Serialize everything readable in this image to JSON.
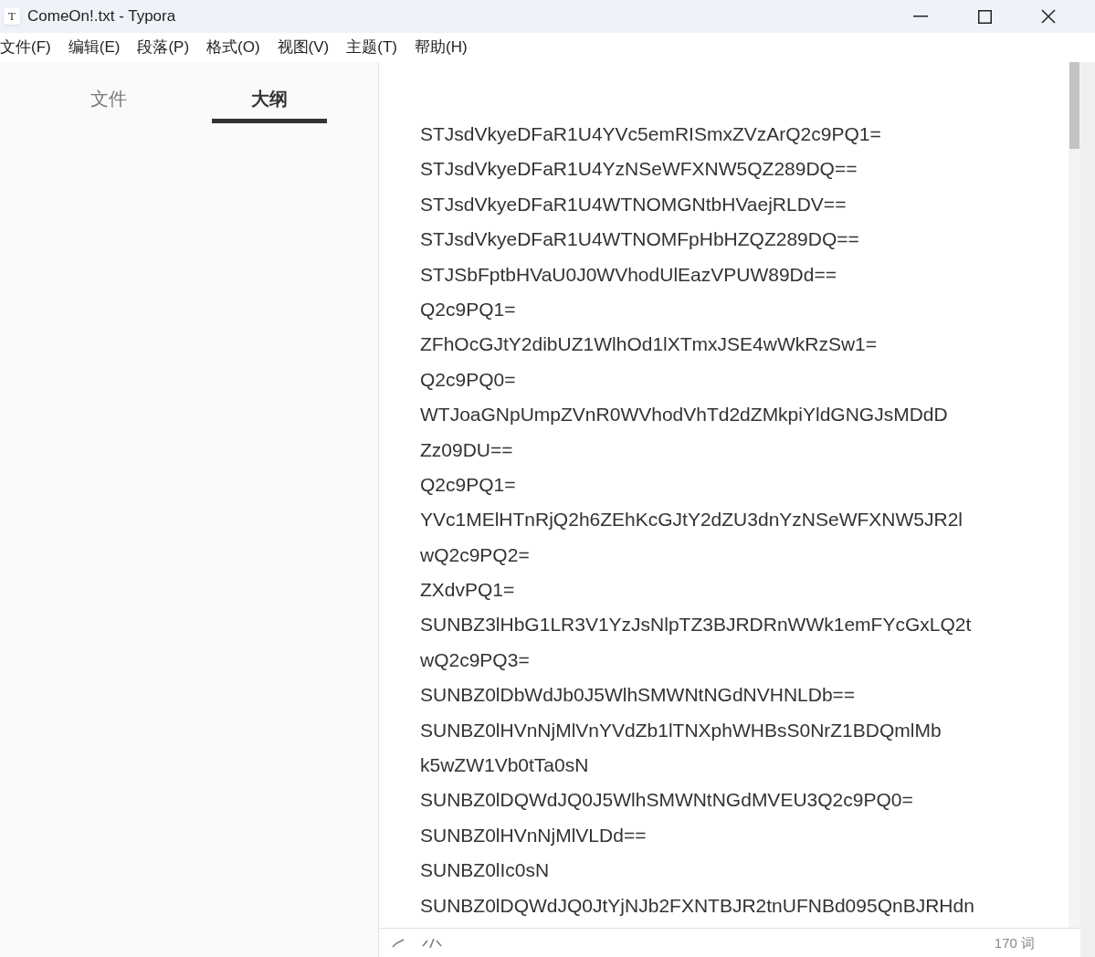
{
  "window": {
    "title": "ComeOn!.txt - Typora",
    "app_icon": "T"
  },
  "menu": [
    "文件(F)",
    "编辑(E)",
    "段落(P)",
    "格式(O)",
    "视图(V)",
    "主题(T)",
    "帮助(H)"
  ],
  "sidebar": {
    "tabs": [
      {
        "label": "文件",
        "selected": false
      },
      {
        "label": "大纲",
        "selected": true
      }
    ]
  },
  "editor": {
    "lines": [
      "STJsdVkyeDFaR1U4YVc5emRISmxZVzArQ2c9PQ1=",
      "STJsdVkyeDFaR1U4YzNSeWFXNW5QZ289DQ==",
      "STJsdVkyeDFaR1U4WTNOMGNtbHVaejRLDV==",
      "STJsdVkyeDFaR1U4WTNOMFpHbHZQZ289DQ==",
      "STJSbFptbHVaU0J0WVhodUlEazVPUW89Dd==",
      "Q2c9PQ1=",
      "ZFhOcGJtY2dibUZ1WlhOd1lXTmxJSE4wWkRzSw1=",
      "Q2c9PQ0=",
      "WTJoaGNpUmpZVnR0WVhodVhTd2dZMkpiYldGNGJsMDdD",
      "Zz09DU==",
      "Q2c9PQ1=",
      "YVc1MElHTnRjQ2h6ZEhKcGJtY2dZU3dnYzNSeWFXNW5JR2l",
      "wQ2c9PQ2=",
      "ZXdvPQ1=",
      "SUNBZ3lHbG1LR3V1YzJsNlpTZ3BJRDRnWWk1emFYcGxLQ2t",
      "wQ2c9PQ3=",
      "SUNBZ0lDbWdJb0J5WlhSMWNtNGdNVHNLDb==",
      "SUNBZ0lHVnNjMlVnYVdZb1lTNXphWHBsS0NrZ1BDQmlMb",
      "k5wZW1Vb0tTa0sN",
      "SUNBZ0lDQWdJQ0J5WlhSMWNtNGdMVEU3Q2c9PQ0=",
      "SUNBZ0lHVnNjMlVLDd==",
      "SUNBZ0lIc0sN",
      "SUNBZ0lDQWdJQ0JtYjNJb2FXNTBJR2tnUFNBd095QnBJRHdn"
    ]
  },
  "status_bar": {
    "word_count": "170 词"
  }
}
